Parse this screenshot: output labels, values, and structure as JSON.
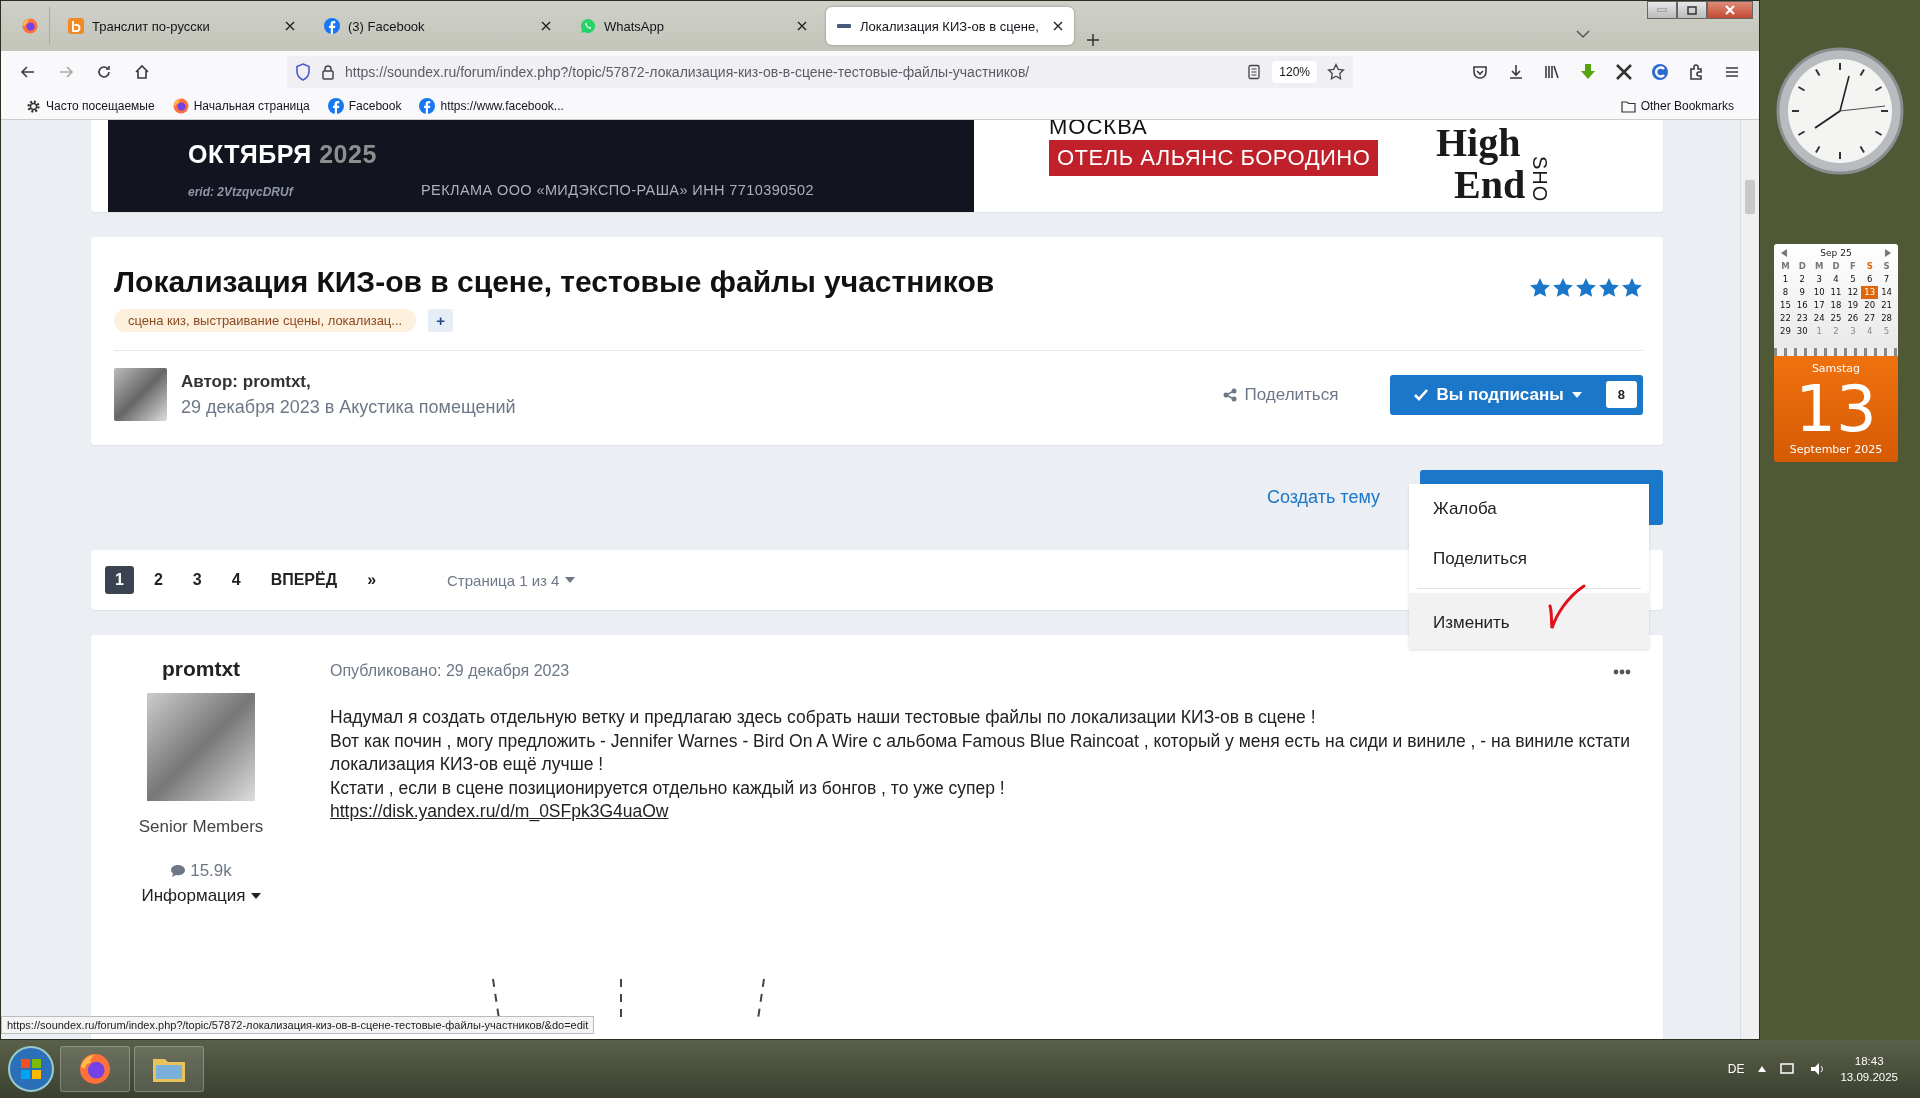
{
  "browser": {
    "tabs": [
      {
        "title": "Транслит по-русски",
        "kind": "translit",
        "selected": false
      },
      {
        "title": "(3) Facebook",
        "kind": "facebook",
        "selected": false
      },
      {
        "title": "WhatsApp",
        "kind": "whatsapp",
        "selected": false
      },
      {
        "title": "Локализация КИЗ-ов в сцене,",
        "kind": "site",
        "selected": true
      }
    ],
    "url": "https://soundex.ru/forum/index.php?/topic/57872-локализация-киз-ов-в-сцене-тестовые-файлы-участников/",
    "zoom": "120%",
    "bookmarks": [
      {
        "label": "Часто посещаемые",
        "kind": "gear"
      },
      {
        "label": "Начальная страница",
        "kind": "firefox"
      },
      {
        "label": "Facebook",
        "kind": "facebook"
      },
      {
        "label": "https://www.facebook...",
        "kind": "facebook"
      }
    ],
    "other_bookmarks": "Other Bookmarks",
    "status_url": "https://soundex.ru/forum/index.php?/topic/57872-локализация-киз-ов-в-сцене-тестовые-файлы-участников/&do=edit"
  },
  "ad_banner": {
    "month": "ОКТЯБРЯ",
    "year": "2025",
    "erid": "erid: 2VtzqvcDRUf",
    "disclaimer": "РЕКЛАМА ООО «МИДЭКСПО-РАША» ИНН 7710390502",
    "city": "МОСКВА",
    "venue": "ОТЕЛЬ АЛЬЯНС БОРОДИНО",
    "logo_top": "High",
    "logo_bottom": "End",
    "logo_side": "SHO"
  },
  "topic": {
    "title": "Локализация КИЗ-ов в сцене, тестовые файлы участников",
    "tags": "сцена киз, выстраивание сцены, локализац...",
    "add_tag": "+",
    "stars": 5,
    "author": "Автор: promtxt,",
    "date_line": "29 декабря 2023 в Акустика помещений",
    "share": "Поделиться",
    "follow": "Вы подписаны",
    "followers": "8"
  },
  "actions": {
    "create_topic": "Создать тему"
  },
  "menu": {
    "items": [
      {
        "label": "Жалоба",
        "selected": false
      },
      {
        "label": "Поделиться",
        "selected": false
      },
      {
        "label": "Изменить",
        "selected": true
      }
    ]
  },
  "pagination": {
    "pages": [
      {
        "label": "1",
        "selected": true
      },
      {
        "label": "2",
        "selected": false
      },
      {
        "label": "3",
        "selected": false
      },
      {
        "label": "4",
        "selected": false
      }
    ],
    "next": "ВПЕРЁД",
    "last": "»",
    "page_info": "Страница 1 из 4"
  },
  "post": {
    "author": "promtxt",
    "group": "Senior Members",
    "post_count": "15.9k",
    "info": "Информация",
    "published": "Опубликовано: 29 декабря 2023",
    "paragraphs": [
      "Надумал я создать отдельную ветку и предлагаю здесь собрать наши тестовые файлы по локализации КИЗ-ов в сцене !",
      "Вот как почин , могу предложить - Jennifer Warnes - Bird On A Wire с альбома Famous Blue Raincoat , который у меня есть на сиди и виниле , - на виниле кстати локализация КИЗ-ов ещё лучше !",
      "Кстати , если в сцене позиционируется отдельно каждый из бонгов , то уже супер !"
    ],
    "link": "https://disk.yandex.ru/d/m_0SFpk3G4uaOw"
  },
  "calendar": {
    "month": "Sep 25",
    "weekdays": [
      {
        "label": "M",
        "selected": false
      },
      {
        "label": "D",
        "selected": false
      },
      {
        "label": "M",
        "selected": false
      },
      {
        "label": "D",
        "selected": false
      },
      {
        "label": "F",
        "selected": false
      },
      {
        "label": "S",
        "selected": true
      },
      {
        "label": "S",
        "selected": false
      }
    ],
    "weeks": [
      [
        {
          "day": "1",
          "other_month": false,
          "selected": false
        },
        {
          "day": "2",
          "other_month": false,
          "selected": false
        },
        {
          "day": "3",
          "other_month": false,
          "selected": false
        },
        {
          "day": "4",
          "other_month": false,
          "selected": false
        },
        {
          "day": "5",
          "other_month": false,
          "selected": false
        },
        {
          "day": "6",
          "other_month": false,
          "selected": false
        },
        {
          "day": "7",
          "other_month": false,
          "selected": false
        }
      ],
      [
        {
          "day": "8",
          "other_month": false,
          "selected": false
        },
        {
          "day": "9",
          "other_month": false,
          "selected": false
        },
        {
          "day": "10",
          "other_month": false,
          "selected": false
        },
        {
          "day": "11",
          "other_month": false,
          "selected": false
        },
        {
          "day": "12",
          "other_month": false,
          "selected": false
        },
        {
          "day": "13",
          "other_month": false,
          "selected": true
        },
        {
          "day": "14",
          "other_month": false,
          "selected": false
        }
      ],
      [
        {
          "day": "15",
          "other_month": false,
          "selected": false
        },
        {
          "day": "16",
          "other_month": false,
          "selected": false
        },
        {
          "day": "17",
          "other_month": false,
          "selected": false
        },
        {
          "day": "18",
          "other_month": false,
          "selected": false
        },
        {
          "day": "19",
          "other_month": false,
          "selected": false
        },
        {
          "day": "20",
          "other_month": false,
          "selected": false
        },
        {
          "day": "21",
          "other_month": false,
          "selected": false
        }
      ],
      [
        {
          "day": "22",
          "other_month": false,
          "selected": false
        },
        {
          "day": "23",
          "other_month": false,
          "selected": false
        },
        {
          "day": "24",
          "other_month": false,
          "selected": false
        },
        {
          "day": "25",
          "other_month": false,
          "selected": false
        },
        {
          "day": "26",
          "other_month": false,
          "selected": false
        },
        {
          "day": "27",
          "other_month": false,
          "selected": false
        },
        {
          "day": "28",
          "other_month": false,
          "selected": false
        }
      ],
      [
        {
          "day": "29",
          "other_month": false,
          "selected": false
        },
        {
          "day": "30",
          "other_month": false,
          "selected": false
        },
        {
          "day": "1",
          "other_month": true,
          "selected": false
        },
        {
          "day": "2",
          "other_month": true,
          "selected": false
        },
        {
          "day": "3",
          "other_month": true,
          "selected": false
        },
        {
          "day": "4",
          "other_month": true,
          "selected": false
        },
        {
          "day": "5",
          "other_month": true,
          "selected": false
        }
      ]
    ],
    "day_name": "Samstag",
    "day": "13",
    "month_year": "September 2025"
  },
  "taskbar": {
    "language": "DE",
    "time": "18:43",
    "date": "13.09.2025"
  }
}
